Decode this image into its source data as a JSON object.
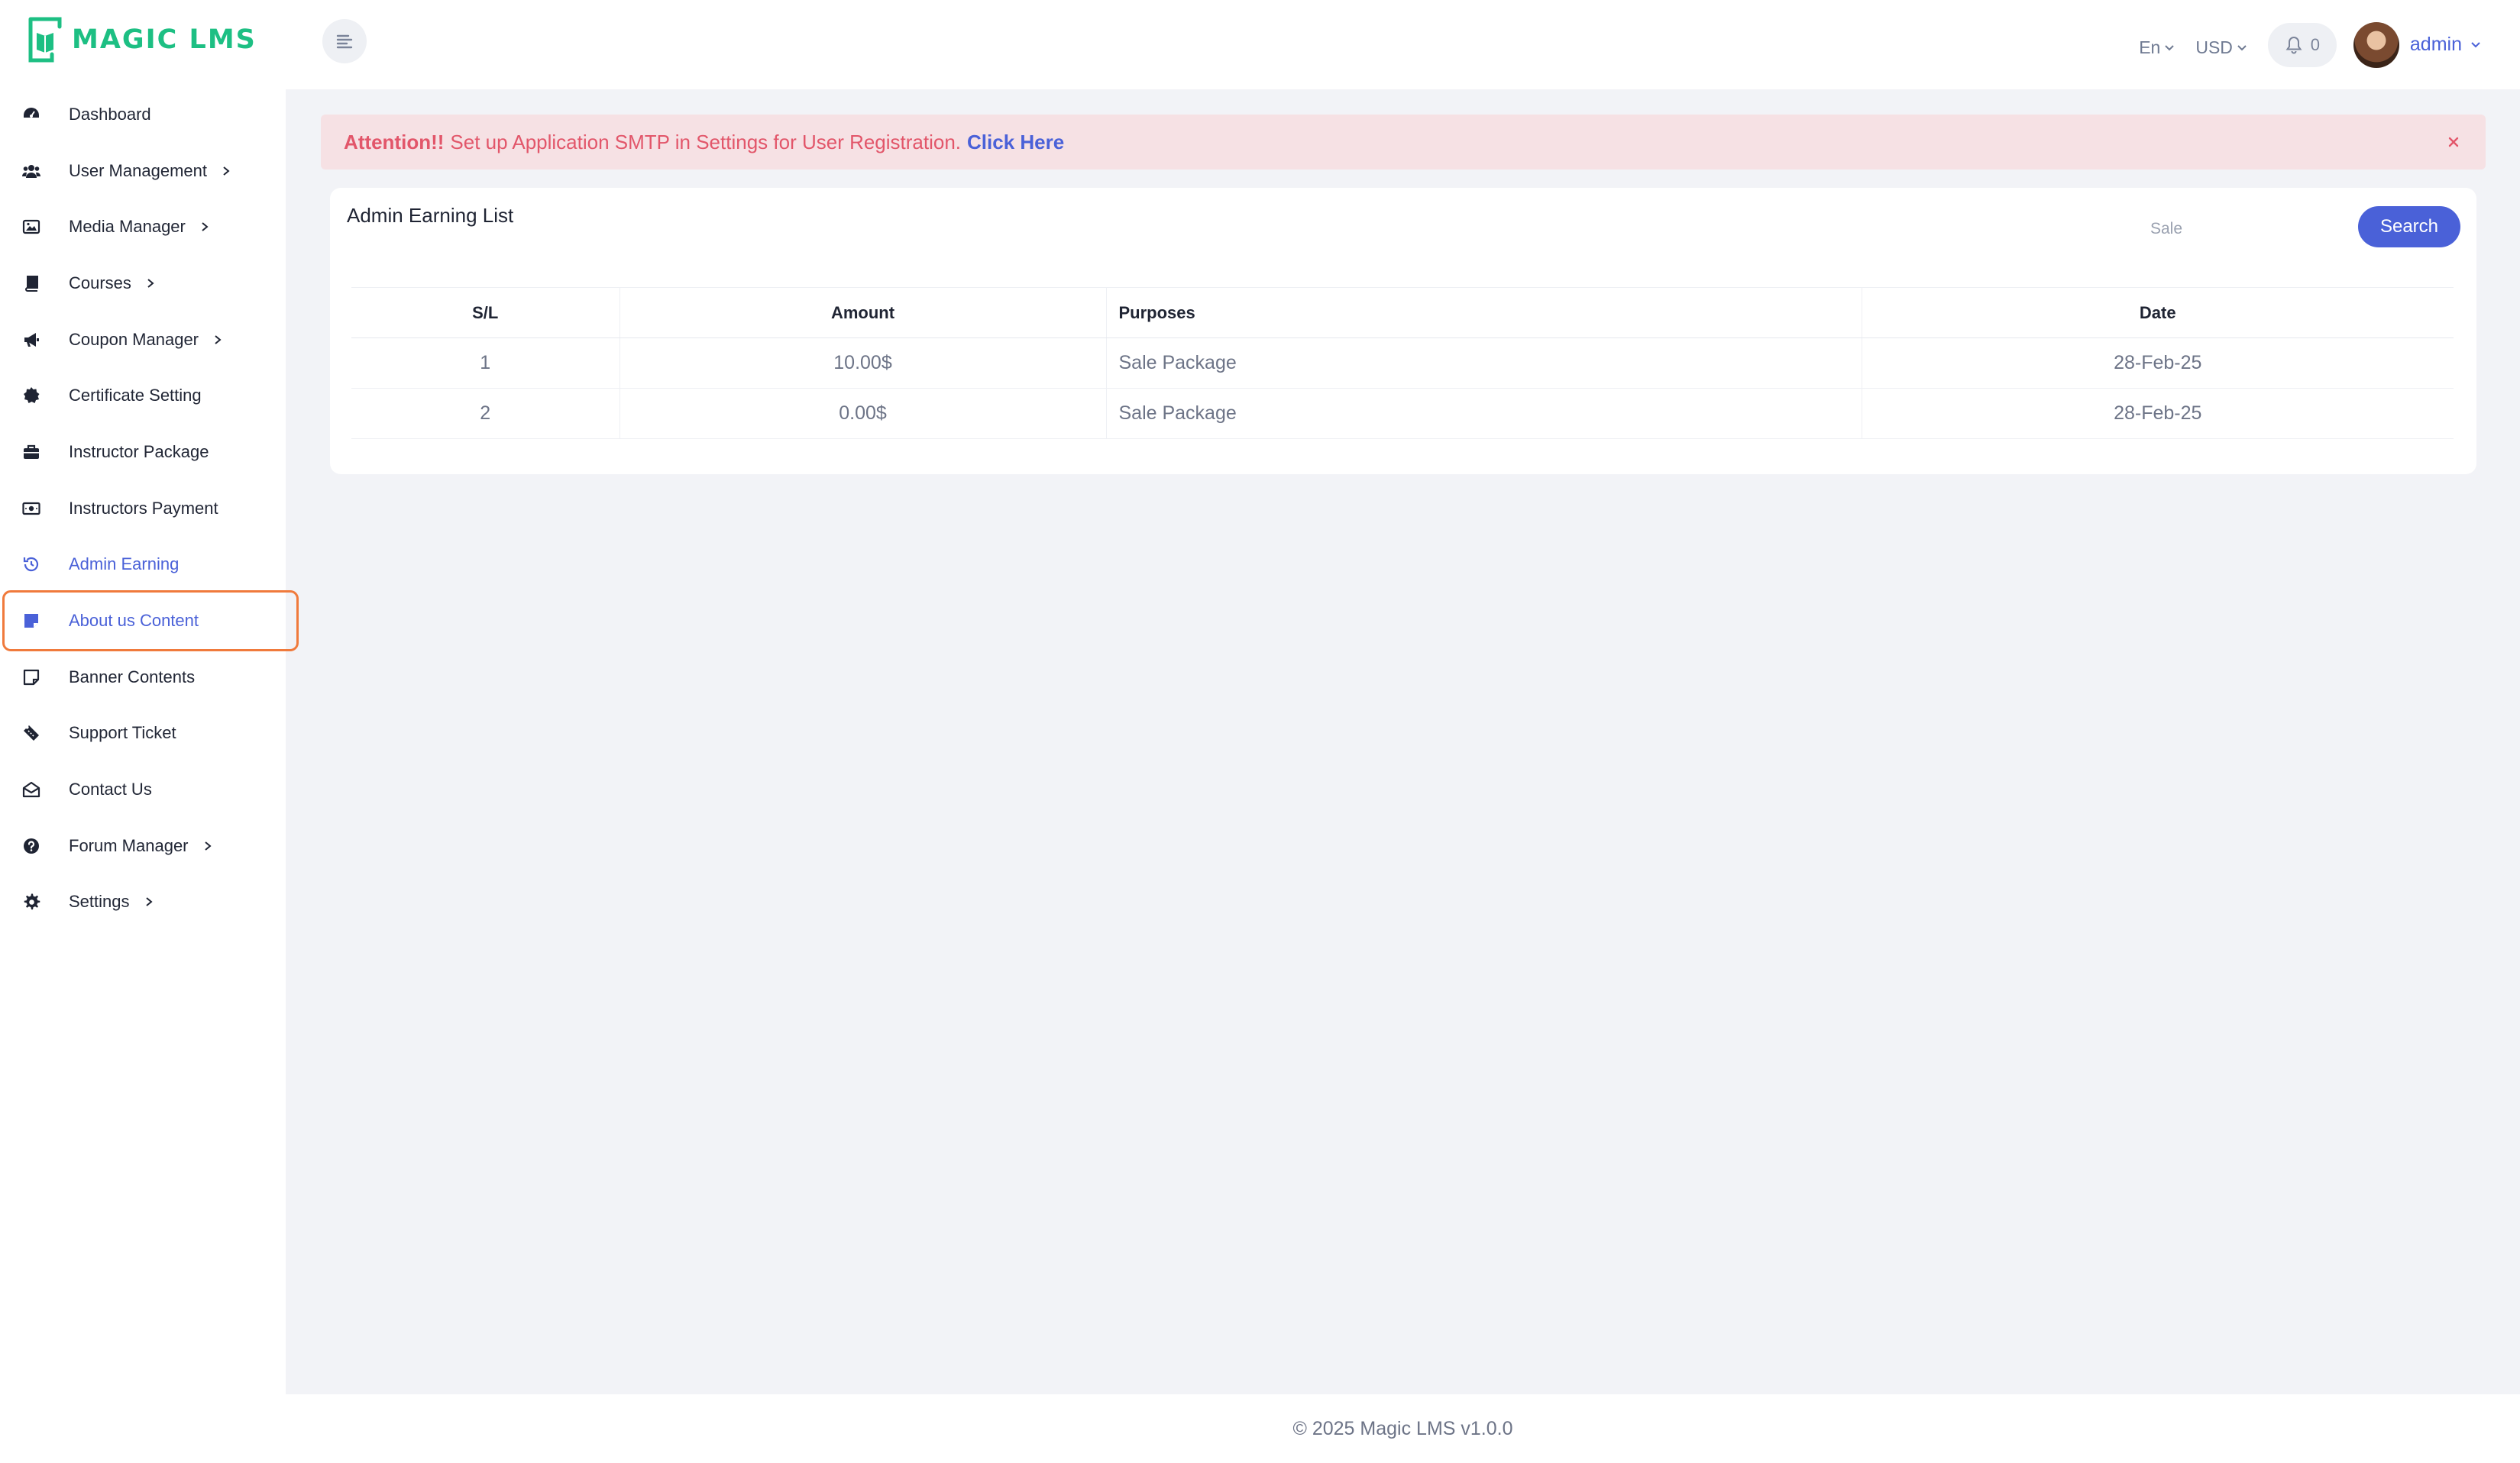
{
  "brand": {
    "name": "MAGIC LMS",
    "color": "#1dbf83"
  },
  "colors": {
    "accent": "#4a61d8",
    "alert_text": "#e2566a",
    "alert_bg": "#f6e1e4",
    "highlight": "#f07a3c"
  },
  "sidebar": {
    "items": [
      {
        "label": "Dashboard",
        "icon": "dashboard-icon",
        "has_children": false
      },
      {
        "label": "User Management",
        "icon": "users-icon",
        "has_children": true
      },
      {
        "label": "Media Manager",
        "icon": "image-icon",
        "has_children": true
      },
      {
        "label": "Courses",
        "icon": "book-icon",
        "has_children": true
      },
      {
        "label": "Coupon Manager",
        "icon": "megaphone-icon",
        "has_children": true
      },
      {
        "label": "Certificate Setting",
        "icon": "badge-icon",
        "has_children": false
      },
      {
        "label": "Instructor Package",
        "icon": "briefcase-icon",
        "has_children": false
      },
      {
        "label": "Instructors Payment",
        "icon": "money-icon",
        "has_children": false
      },
      {
        "label": "Admin Earning",
        "icon": "history-icon",
        "has_children": false,
        "active": true
      },
      {
        "label": "About us Content",
        "icon": "note-icon",
        "has_children": false,
        "highlighted": true
      },
      {
        "label": "Banner Contents",
        "icon": "sticky-note-icon",
        "has_children": false
      },
      {
        "label": "Support Ticket",
        "icon": "ticket-icon",
        "has_children": false
      },
      {
        "label": "Contact Us",
        "icon": "envelope-open-icon",
        "has_children": false
      },
      {
        "label": "Forum Manager",
        "icon": "question-circle-icon",
        "has_children": true
      },
      {
        "label": "Settings",
        "icon": "gear-icon",
        "has_children": true
      }
    ]
  },
  "header": {
    "language": "En",
    "currency": "USD",
    "notification_count": "0",
    "user": "admin"
  },
  "alert": {
    "prefix": "Attention!!",
    "message": "Set up Application SMTP in Settings for User Registration.",
    "link": "Click Here"
  },
  "card": {
    "title": "Admin Earning List",
    "search": {
      "value": "",
      "placeholder": "Sale",
      "button": "Search"
    },
    "table": {
      "columns": [
        "S/L",
        "Amount",
        "Purposes",
        "Date"
      ],
      "rows": [
        [
          "1",
          "10.00$",
          "Sale Package",
          "28-Feb-25"
        ],
        [
          "2",
          "0.00$",
          "Sale Package",
          "28-Feb-25"
        ]
      ]
    }
  },
  "footer": {
    "text": "© 2025 Magic LMS v1.0.0"
  }
}
